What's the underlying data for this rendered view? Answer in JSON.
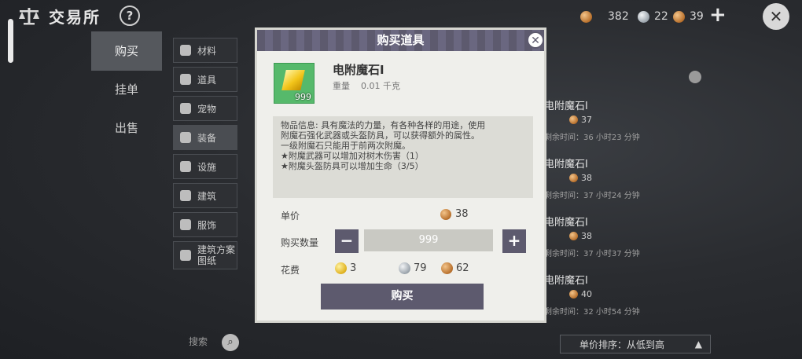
{
  "topbar": {
    "title": "交易所",
    "help_label": "?",
    "currency": [
      {
        "name": "bronze",
        "value": "382"
      },
      {
        "name": "silver",
        "value": "22"
      },
      {
        "name": "bronze",
        "value": "39"
      }
    ],
    "plus_label": "+",
    "close_label": "✕"
  },
  "tabs": [
    {
      "label": "购买"
    },
    {
      "label": "挂单"
    },
    {
      "label": "出售"
    }
  ],
  "categories": [
    {
      "label": "材料"
    },
    {
      "label": "道具"
    },
    {
      "label": "宠物"
    },
    {
      "label": "装备"
    },
    {
      "label": "设施"
    },
    {
      "label": "建筑"
    },
    {
      "label": "服饰"
    },
    {
      "label": "建筑方案图纸"
    }
  ],
  "search": {
    "label": "搜索"
  },
  "listings": [
    {
      "name": "电附魔石I",
      "price": "37",
      "time": "剩余时间：36 小时23 分钟"
    },
    {
      "name": "电附魔石I",
      "price": "38",
      "time": "剩余时间：37 小时24 分钟"
    },
    {
      "name": "电附魔石I",
      "price": "38",
      "time": "剩余时间：37 小时37 分钟"
    },
    {
      "name": "电附魔石I",
      "price": "40",
      "time": "剩余时间：32 小时54 分钟"
    }
  ],
  "sort": {
    "label": "单价排序：从低到高"
  },
  "dialog": {
    "title": "购买道具",
    "item_name": "电附魔石I",
    "item_count": "999",
    "weight_label": "重量",
    "weight_value": "0.01 千克",
    "description": [
      "物品信息: 具有魔法的力量，有各种各样的用途，使用",
      "附魔石强化武器或头盔防具，可以获得额外的属性。",
      "一级附魔石只能用于前两次附魔。",
      "★附魔武器可以增加对树木伤害（1）",
      "★附魔头盔防具可以增加生命（3/5）"
    ],
    "unit_price_label": "单价",
    "unit_price": "38",
    "qty_label": "购买数量",
    "qty_value": "999",
    "minus_label": "−",
    "plus_label": "+",
    "cost_label": "花费",
    "cost": [
      {
        "coin": "gold",
        "value": "3"
      },
      {
        "coin": "silver",
        "value": "79"
      },
      {
        "coin": "bronze",
        "value": "62"
      }
    ],
    "buy_label": "购买"
  }
}
